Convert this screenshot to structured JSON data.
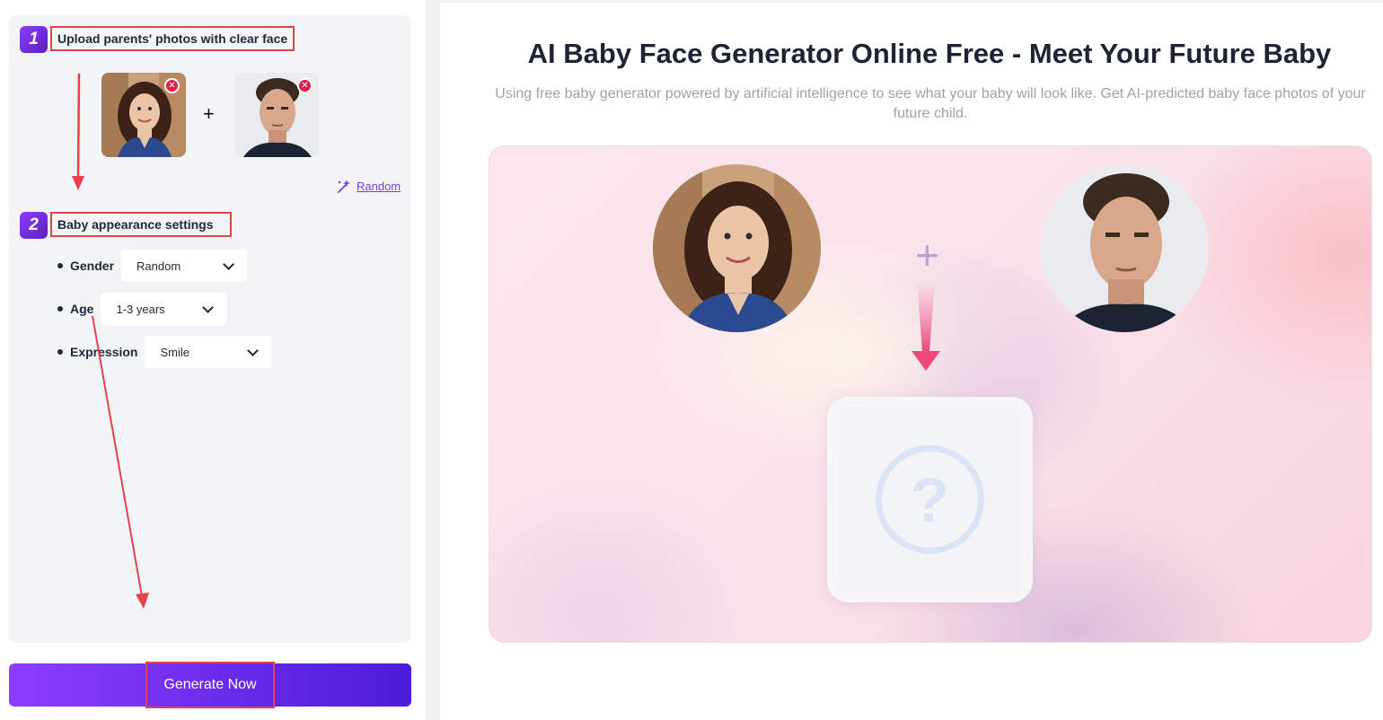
{
  "left_panel": {
    "step1": {
      "number": "1",
      "title": "Upload parents' photos with clear face"
    },
    "step2": {
      "number": "2",
      "title": "Baby appearance settings"
    },
    "photos": {
      "parent1_alt": "mother photo",
      "parent2_alt": "father photo",
      "plus": "+"
    },
    "random_label": "Random",
    "settings": [
      {
        "label": "Gender",
        "value": "Random"
      },
      {
        "label": "Age",
        "value": "1-3 years"
      },
      {
        "label": "Expression",
        "value": "Smile"
      }
    ],
    "generate_label": "Generate Now"
  },
  "hero": {
    "title": "AI Baby Face Generator Online Free - Meet Your Future Baby",
    "subtitle": "Using free baby generator powered by artificial intelligence to see what your baby will look like. Get AI-predicted baby face photos of your future child."
  },
  "preview": {
    "plus": "+",
    "result_placeholder": "?"
  },
  "colors": {
    "accent": "#7c3aed",
    "button_gradient_start": "#8b3dff",
    "button_gradient_end": "#4c1dd8",
    "annotation_red": "#e3424b",
    "remove_badge": "#e11d48"
  }
}
